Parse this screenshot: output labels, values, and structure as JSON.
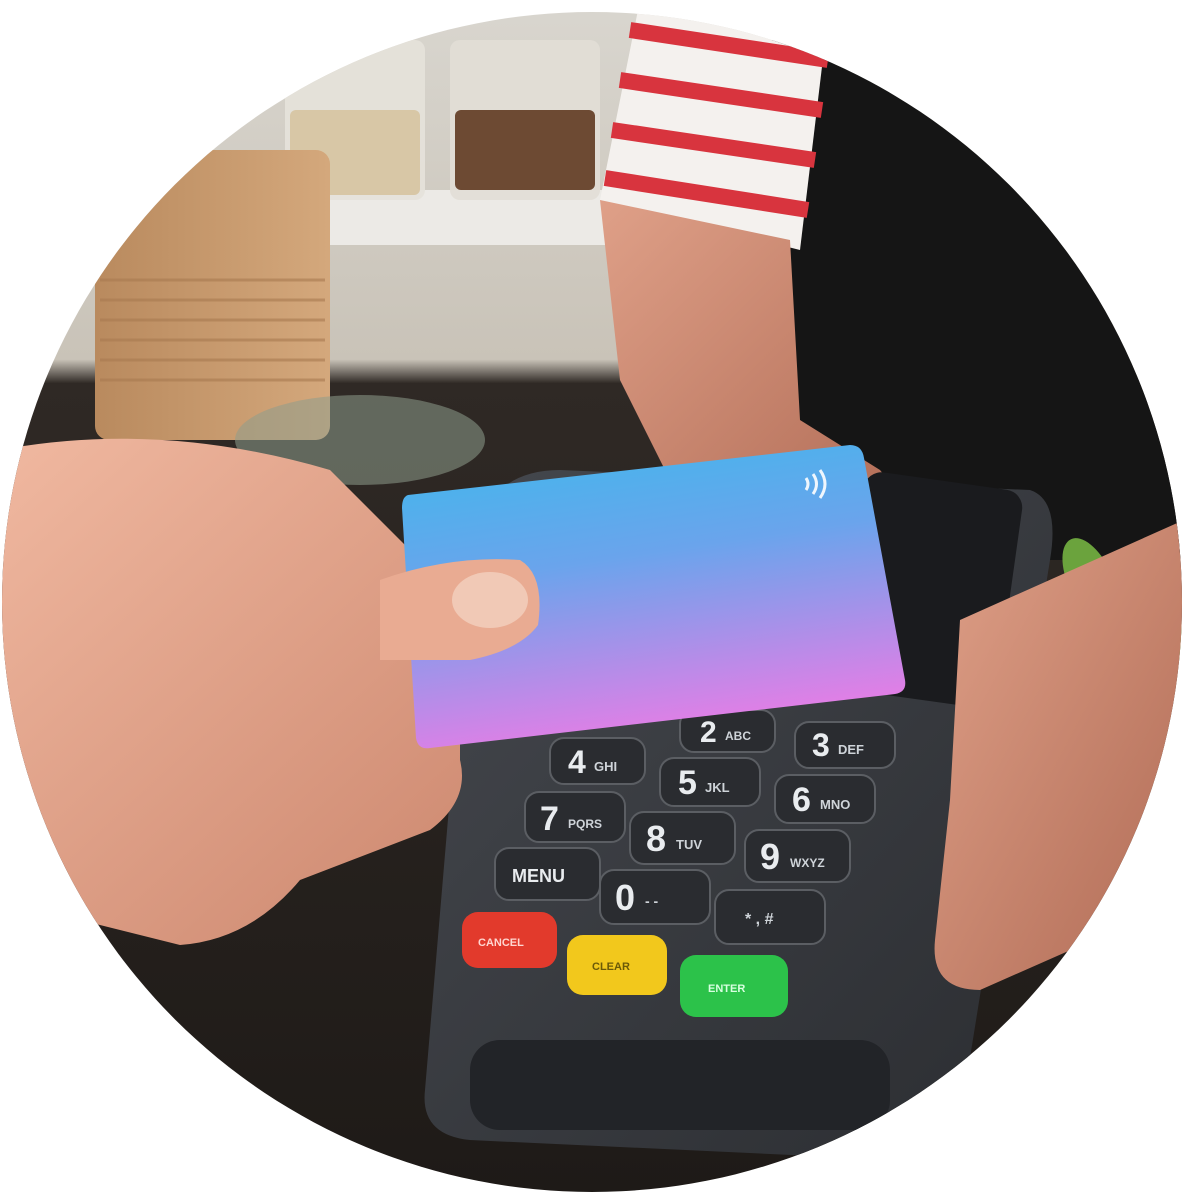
{
  "image": {
    "subject": "contactless-card-payment",
    "shape": "circle",
    "colors": {
      "background": "#ffffff",
      "counter": "#2a2521",
      "card_top": "#3fb8ec",
      "card_bottom": "#e07fe6",
      "terminal": "#3a3d42",
      "cancel": "#e23a2c",
      "clear": "#f2c81c",
      "enter": "#2cc24a",
      "shirt_stripe": "#d8343e"
    }
  },
  "terminal": {
    "keys": [
      {
        "num": "2",
        "letters": "ABC"
      },
      {
        "num": "3",
        "letters": "DEF"
      },
      {
        "num": "4",
        "letters": "GHI"
      },
      {
        "num": "5",
        "letters": "JKL"
      },
      {
        "num": "6",
        "letters": "MNO"
      },
      {
        "num": "7",
        "letters": "PQRS"
      },
      {
        "num": "8",
        "letters": "TUV"
      },
      {
        "num": "9",
        "letters": "WXYZ"
      },
      {
        "num": "0",
        "letters": "- -"
      }
    ],
    "menu_label": "MENU",
    "dot_key": "* , #",
    "cancel_label": "CANCEL",
    "clear_label": "CLEAR",
    "enter_label": "ENTER"
  },
  "card": {
    "contactless_icon": "contactless-icon"
  }
}
